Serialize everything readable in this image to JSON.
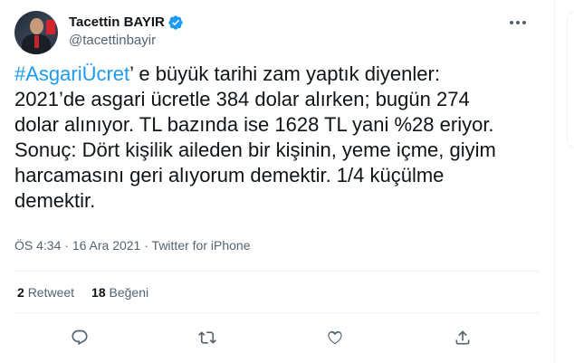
{
  "author": {
    "display_name": "Tacettin BAYIR",
    "handle": "@tacettinbayir"
  },
  "tweet": {
    "hashtag": "#AsgariÜcret",
    "body": "’ e büyük tarihi zam yaptık diyenler:\n2021’de asgari ücretle 384 dolar alırken; bugün 274\ndolar alınıyor. TL bazında ise 1628 TL yani %28 eriyor.\nSonuç: Dört kişilik aileden bir kişinin, yeme içme, giyim\nharcamasını geri alıyorum demektir. 1/4 küçülme\ndemektir."
  },
  "meta": {
    "time": "ÖS 4:34",
    "separator_dot": "·",
    "date": "16 Ara 2021",
    "client": "Twitter for iPhone"
  },
  "stats": {
    "retweets_count": "2",
    "retweets_label": "Retweet",
    "likes_count": "18",
    "likes_label": "Beğeni"
  },
  "icons": {
    "verified": "verified-badge-icon",
    "more": "more-options-icon",
    "reply": "reply-icon",
    "retweet": "retweet-icon",
    "like": "like-heart-icon",
    "share": "share-icon"
  },
  "colors": {
    "accent": "#1d9bf0",
    "text": "#0f1419",
    "secondary": "#536471",
    "divider": "#eff3f4"
  }
}
